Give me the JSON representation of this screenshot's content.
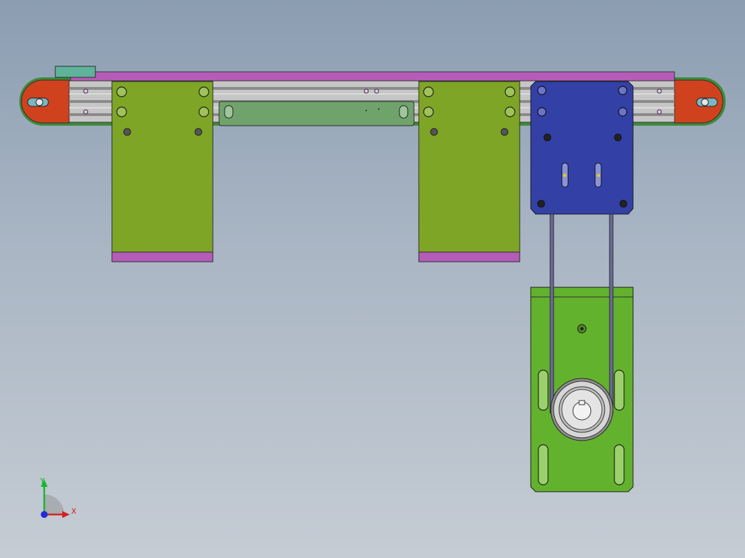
{
  "colors": {
    "rail": "#c6c6c6",
    "rail_slot": "#8a8a8a",
    "belt_top": "#b45cb8",
    "end_cap": "#d0421e",
    "hook_block": "#5fb39a",
    "bracket": "#7ea526",
    "bracket_foot": "#b45cb8",
    "guide_plate": "#6fa36b",
    "motor_plate": "#3340a6",
    "base_plate": "#63b22e",
    "pulley": "#d6d6d6",
    "drive_belt": "#6a6a92"
  },
  "icons": {
    "triad": "xyz-axis-triad-icon"
  },
  "axes": {
    "x_label": "X",
    "y_label": "Y",
    "x_color": "#d42020",
    "y_color": "#19b431",
    "z_color": "#1f2bd6"
  }
}
